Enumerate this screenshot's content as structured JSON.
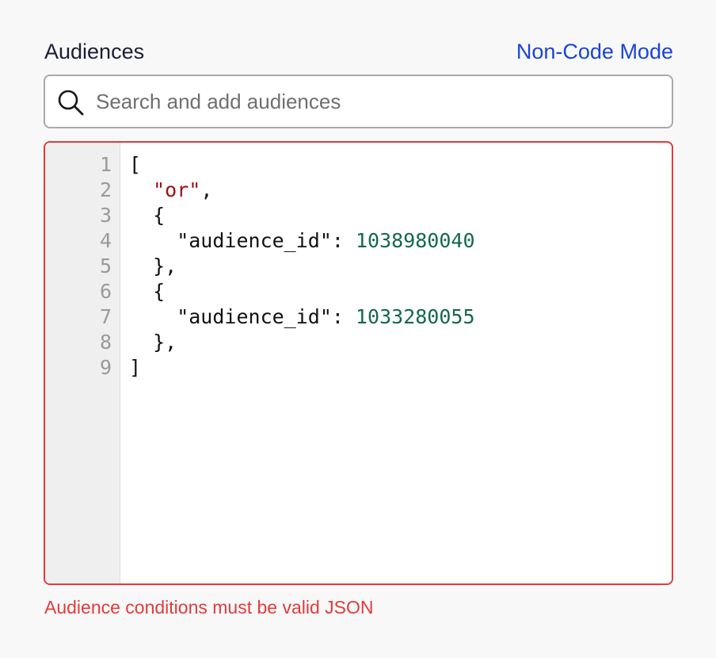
{
  "header": {
    "title": "Audiences",
    "mode_link": "Non-Code Mode"
  },
  "search": {
    "placeholder": "Search and add audiences",
    "value": "",
    "icon": "search-icon"
  },
  "editor": {
    "line_numbers": [
      "1",
      "2",
      "3",
      "4",
      "5",
      "6",
      "7",
      "8",
      "9"
    ],
    "lines": [
      [
        {
          "text": "[",
          "type": "plain"
        }
      ],
      [
        {
          "text": "  ",
          "type": "plain"
        },
        {
          "text": "\"or\"",
          "type": "string"
        },
        {
          "text": ",",
          "type": "plain"
        }
      ],
      [
        {
          "text": "  {",
          "type": "plain"
        }
      ],
      [
        {
          "text": "    \"audience_id\": ",
          "type": "plain"
        },
        {
          "text": "1038980040",
          "type": "number"
        }
      ],
      [
        {
          "text": "  },",
          "type": "plain"
        }
      ],
      [
        {
          "text": "  {",
          "type": "plain"
        }
      ],
      [
        {
          "text": "    \"audience_id\": ",
          "type": "plain"
        },
        {
          "text": "1033280055",
          "type": "number"
        }
      ],
      [
        {
          "text": "  },",
          "type": "plain"
        }
      ],
      [
        {
          "text": "]",
          "type": "plain"
        }
      ]
    ],
    "colors": {
      "string": "#a11111",
      "number": "#14694a",
      "error_border": "#e23b3b"
    }
  },
  "error": {
    "message": "Audience conditions must be valid JSON"
  }
}
